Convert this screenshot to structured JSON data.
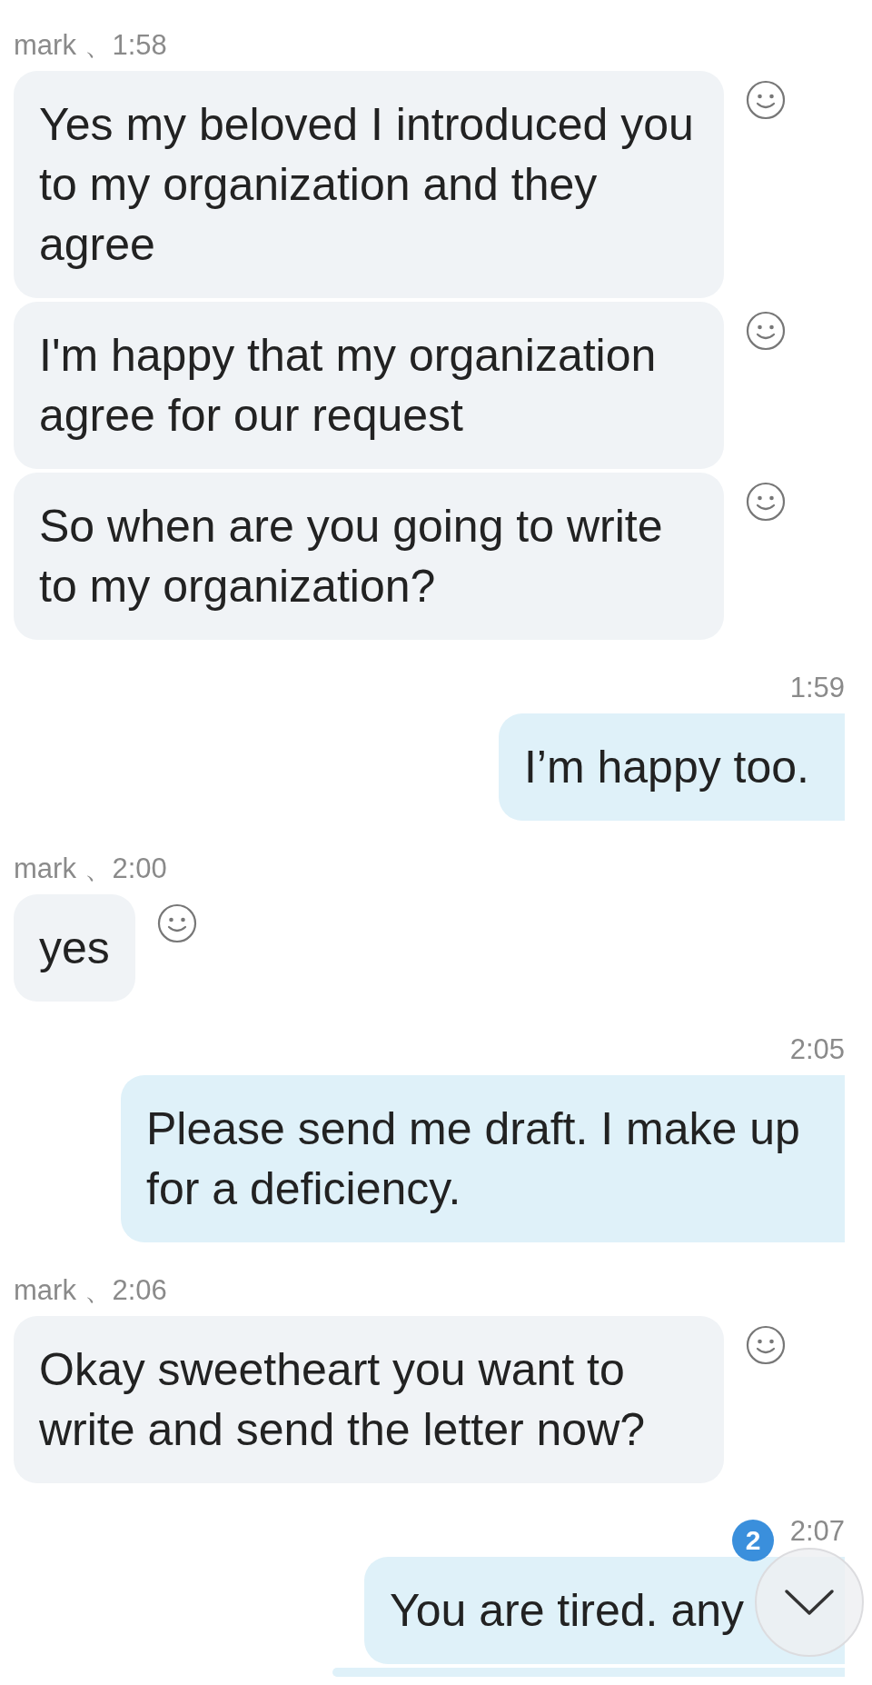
{
  "conversation": [
    {
      "kind": "incoming",
      "header": "mark 、1:58",
      "messages": [
        {
          "text": "Yes my beloved I introduced you to my organization and they agree"
        },
        {
          "text": "I'm happy that my organization agree for our request"
        },
        {
          "text": "So when are you going to write to my organization?"
        }
      ]
    },
    {
      "kind": "outgoing",
      "header": "1:59",
      "messages": [
        {
          "text": "I’m happy too."
        }
      ]
    },
    {
      "kind": "incoming",
      "header": "mark 、2:00",
      "messages": [
        {
          "text": "yes"
        }
      ]
    },
    {
      "kind": "outgoing",
      "header": "2:05",
      "messages": [
        {
          "text": "Please send me draft. I make up for a deficiency."
        }
      ]
    },
    {
      "kind": "incoming",
      "header": "mark 、2:06",
      "messages": [
        {
          "text": "Okay sweetheart you want to write and send the letter now?"
        }
      ]
    },
    {
      "kind": "outgoing",
      "header": "2:07",
      "messages": [
        {
          "kind": "text",
          "text": "You are tired. any",
          "covered": true
        },
        {
          "kind": "cut_off"
        }
      ]
    }
  ],
  "scroll_button": {
    "badge": "2"
  }
}
